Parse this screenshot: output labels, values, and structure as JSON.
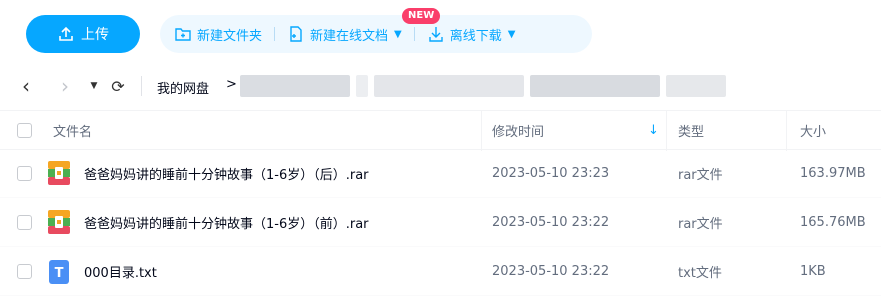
{
  "toolbar": {
    "upload_label": "上传",
    "new_folder_label": "新建文件夹",
    "new_online_doc_label": "新建在线文档",
    "new_badge": "NEW",
    "offline_download_label": "离线下载",
    "accent_color": "#06a7ff"
  },
  "pathbar": {
    "root": "我的网盘",
    "separator": ">"
  },
  "table": {
    "headers": {
      "name": "文件名",
      "modified": "修改时间",
      "type": "类型",
      "size": "大小"
    },
    "sort_arrow": "↓",
    "rows": [
      {
        "name": "爸爸妈妈讲的睡前十分钟故事（1-6岁）（后）.rar",
        "modified": "2023-05-10 23:23",
        "type": "rar文件",
        "size": "163.97MB",
        "icon": "rar-file-icon"
      },
      {
        "name": "爸爸妈妈讲的睡前十分钟故事（1-6岁）（前）.rar",
        "modified": "2023-05-10 23:22",
        "type": "rar文件",
        "size": "165.76MB",
        "icon": "rar-file-icon"
      },
      {
        "name": "000目录.txt",
        "modified": "2023-05-10 23:22",
        "type": "txt文件",
        "size": "1KB",
        "icon": "txt-file-icon"
      }
    ]
  }
}
